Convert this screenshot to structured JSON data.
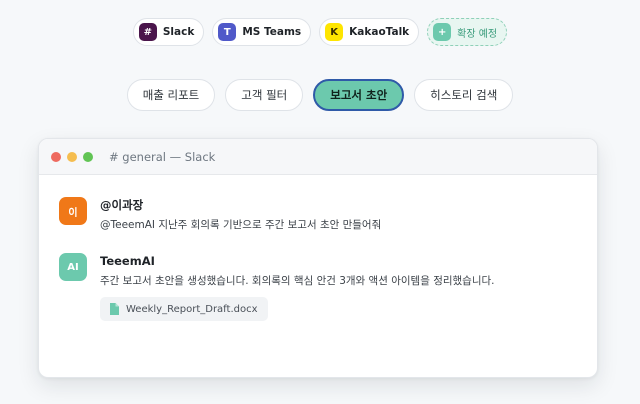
{
  "platforms": [
    {
      "label": "Slack",
      "badge": "#",
      "color": "#4a154b"
    },
    {
      "label": "MS Teams",
      "badge": "T",
      "color": "#5059c9"
    },
    {
      "label": "KakaoTalk",
      "badge": "K",
      "color": "#fee500"
    }
  ],
  "extension": {
    "label": "확장 예정",
    "badge": "+"
  },
  "tabs": [
    {
      "label": "매출 리포트",
      "active": false
    },
    {
      "label": "고객 필터",
      "active": false
    },
    {
      "label": "보고서 초안",
      "active": true
    },
    {
      "label": "히스토리 검색",
      "active": false
    }
  ],
  "window": {
    "title": "# general — Slack",
    "messages": [
      {
        "avatar": "이",
        "avatar_color": "#f07818",
        "author": "@이과장",
        "text": "@TeeemAI 지난주 회의록 기반으로 주간 보고서 초안 만들어줘"
      },
      {
        "avatar": "AI",
        "avatar_color": "#6cc9ad",
        "author": "TeeemAI",
        "text": "주간 보고서 초안을 생성했습니다. 회의록의 핵심 안건 3개와 액션 아이템을 정리했습니다.",
        "attachment": "Weekly_Report_Draft.docx"
      }
    ]
  },
  "colors": {
    "accent": "#6cc9ad",
    "active_border": "#2f5aa8",
    "dot_red": "#ee6a5f",
    "dot_yellow": "#f5bd4f",
    "dot_green": "#61c454"
  }
}
